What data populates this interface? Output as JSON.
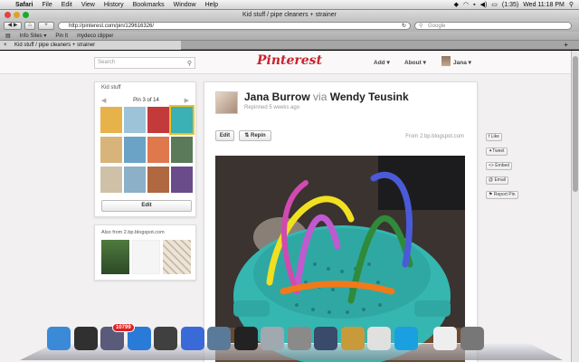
{
  "menubar": {
    "app": "Safari",
    "items": [
      "File",
      "Edit",
      "View",
      "History",
      "Bookmarks",
      "Window",
      "Help"
    ],
    "battery": "(1:35)",
    "clock": "Wed 11:18 PM"
  },
  "window": {
    "title": "Kid stuff / pipe cleaners + strainer",
    "url": "http://pinterest.com/pin/129616326/",
    "search_placeholder": "Google",
    "bookmarks": [
      "Info Sites ▾",
      "Pin It",
      "mydeco clipper"
    ],
    "tab_title": "Kid stuff / pipe cleaners + strainer"
  },
  "header": {
    "search_placeholder": "Search",
    "logo": "Pinterest",
    "nav": {
      "add": "Add",
      "about": "About",
      "user": "Jana"
    }
  },
  "board": {
    "title": "Kid stuff",
    "pager": "Pin 3 of 14",
    "edit_label": "Edit",
    "thumb_colors": [
      "#e8b24a",
      "#9cc3d8",
      "#c23a3a",
      "#3bb0b5",
      "#d9b47a",
      "#6aa3c6",
      "#e0784d",
      "#5a7a5a",
      "#cfc0a8",
      "#8bb0c8",
      "#b06840",
      "#6a4c8a"
    ]
  },
  "also": {
    "title": "Also from 2.bp.blogspot.com"
  },
  "pin": {
    "pinner": "Jana Burrow",
    "via": "via",
    "original": "Wendy Teusink",
    "repinned": "Repinned 5 weeks ago",
    "edit_label": "Edit",
    "repin_label": "Repin",
    "source": "From 2.bp.blogspot.com"
  },
  "social": {
    "like": "Like",
    "tweet": "Tweet",
    "embed": "Embed",
    "email": "Email",
    "report": "Report Pin"
  },
  "dock": {
    "badge": "10799",
    "icons": [
      "finder-icon",
      "dashboard-icon",
      "mail-icon",
      "safari-icon",
      "photo-booth-icon",
      "itunes-icon",
      "iphoto-icon",
      "imovie-icon",
      "preview-icon",
      "system-preferences-icon",
      "ink-icon",
      "keynote-icon",
      "picasa-icon",
      "skype-icon",
      "documents-icon",
      "trash-icon"
    ]
  }
}
